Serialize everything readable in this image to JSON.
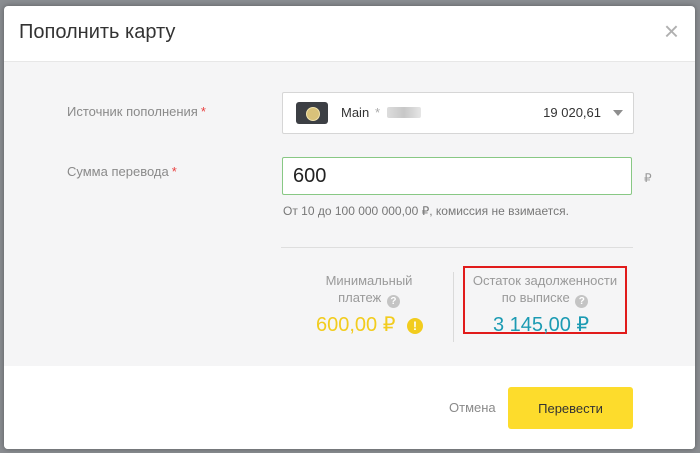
{
  "dialog": {
    "title": "Пополнить карту",
    "close_icon": "close-icon",
    "close_glyph": "×"
  },
  "source": {
    "label": "Источник пополнения",
    "required_mark": "*",
    "card_name": "Main",
    "card_mask": "*",
    "balance": "19 020,61",
    "card_icon": "card-icon",
    "caret_icon": "chevron-down-icon"
  },
  "amount": {
    "label": "Сумма перевода",
    "required_mark": "*",
    "value": "600",
    "currency": "₽",
    "hint": "От 10 до 100 000 000,00 ₽, комиссия не взимается."
  },
  "min_payment": {
    "label_line1": "Минимальный",
    "label_line2": "платеж",
    "amount": "600,00 ₽",
    "help_glyph": "?",
    "warn_glyph": "!"
  },
  "debt": {
    "label_line1": "Остаток задолженности",
    "label_line2": "по выписке",
    "amount": "3 145,00 ₽",
    "help_glyph": "?"
  },
  "footer": {
    "cancel_label": "Отмена",
    "submit_label": "Перевести"
  },
  "colors": {
    "accent_yellow": "#fddc2c",
    "min_payment_color": "#f2cc1e",
    "debt_color": "#1c9bb3",
    "highlight_border": "#e11b1b",
    "input_border": "#88c884"
  }
}
